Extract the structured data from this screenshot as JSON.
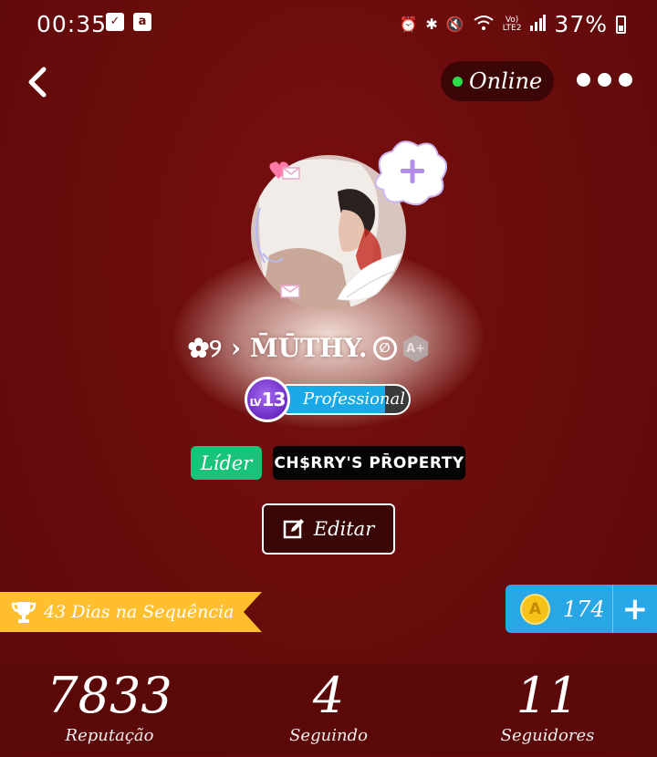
{
  "status_bar": {
    "time": "00:35",
    "battery": "37%",
    "network": "LTE2"
  },
  "header": {
    "online_label": "Online"
  },
  "profile": {
    "username": "✿୨ › M̄ŪTHY.",
    "level_number": "13",
    "level_prefix": "LV",
    "level_title": "Professional",
    "level_progress": 0.82,
    "leader_label": "Líder",
    "custom_title": "CH$RRY'S PR̄OPERTY",
    "edit_label": "Editar",
    "amino_plus_badge": "A+"
  },
  "streak": {
    "label": "43 Dias na Sequência"
  },
  "coins": {
    "value": "174",
    "add_label": "+"
  },
  "stats": [
    {
      "value": "7833",
      "label": "Reputação"
    },
    {
      "value": "4",
      "label": "Seguindo"
    },
    {
      "value": "11",
      "label": "Seguidores"
    }
  ],
  "colors": {
    "background": "#6a0c0c",
    "online_dot": "#2ddc4b",
    "level_fill": "#19a9e6",
    "leader_badge": "#17c47a",
    "streak_banner": "#ffbf2e",
    "coins_box": "#29a6e6"
  }
}
